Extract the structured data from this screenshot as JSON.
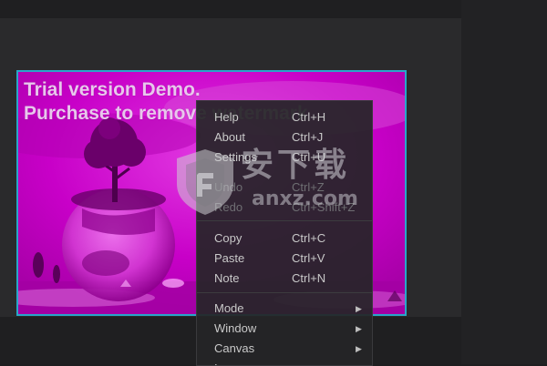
{
  "canvas": {
    "watermark_line_1": "Trial version Demo.",
    "watermark_line_2": "Purchase to remove watermark",
    "frame_color": "#29a6c9",
    "tint_color": "#c400c4"
  },
  "context_menu": {
    "groups": [
      [
        {
          "label": "Help",
          "shortcut": "Ctrl+H"
        },
        {
          "label": "About",
          "shortcut": "Ctrl+J"
        },
        {
          "label": "Settings",
          "shortcut": "Ctrl+U"
        },
        {
          "label": "Undo",
          "shortcut": "Ctrl+Z",
          "disabled": true
        },
        {
          "label": "Redo",
          "shortcut": "Ctrl+Shift+Z",
          "disabled": true
        }
      ],
      [
        {
          "label": "Copy",
          "shortcut": "Ctrl+C"
        },
        {
          "label": "Paste",
          "shortcut": "Ctrl+V"
        },
        {
          "label": "Note",
          "shortcut": "Ctrl+N"
        }
      ],
      [
        {
          "label": "Mode",
          "submenu": true,
          "icon": "chevron-right-icon"
        },
        {
          "label": "Window",
          "submenu": true,
          "icon": "chevron-right-icon"
        },
        {
          "label": "Canvas",
          "submenu": true,
          "icon": "chevron-right-icon"
        },
        {
          "label": "Image",
          "submenu": true,
          "icon": "chevron-right-icon"
        }
      ]
    ]
  },
  "site_watermark": {
    "cn_text": "安下载",
    "en_text": "anxz.com",
    "icon": "shield-icon"
  }
}
